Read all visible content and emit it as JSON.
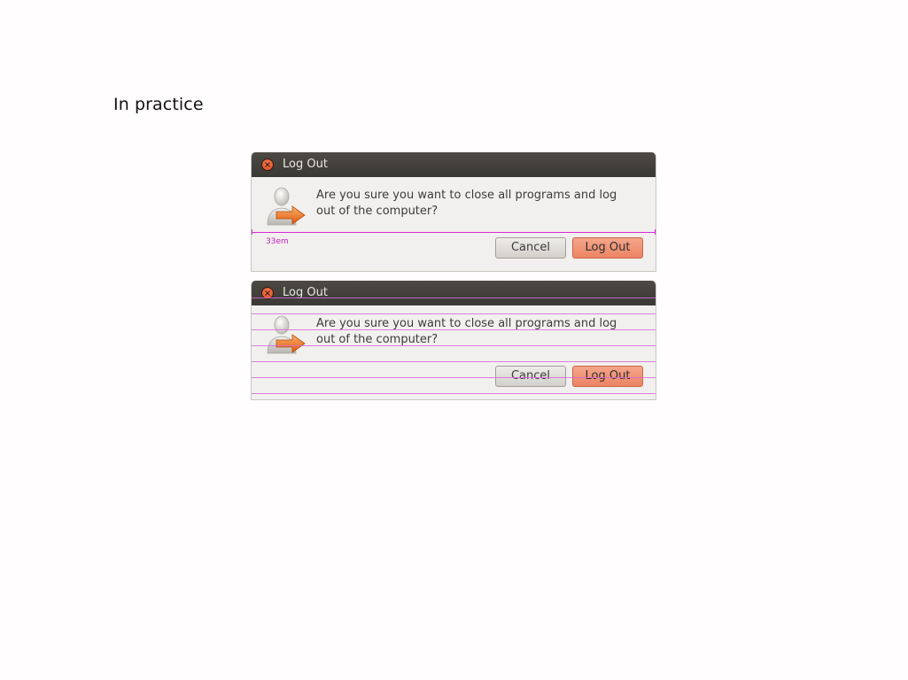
{
  "page": {
    "title": "In practice"
  },
  "dialogs": [
    {
      "window_title": "Log Out",
      "message": "Are you sure you want to close all programs and log out of the computer?",
      "buttons": {
        "cancel": "Cancel",
        "logout": "Log Out"
      },
      "overlay": {
        "type": "width-measure",
        "label": "33em"
      }
    },
    {
      "window_title": "Log Out",
      "message": "Are you sure you want to close all programs and log out of the computer?",
      "buttons": {
        "cancel": "Cancel",
        "logout": "Log Out"
      },
      "overlay": {
        "type": "baseline-grid"
      }
    }
  ],
  "icons": {
    "close": "close-icon",
    "logout": "user-logout-icon"
  },
  "colors": {
    "titlebar": "#3f3d39",
    "dialog_bg": "#f2f0ee",
    "accent_button": "#ef8e6e",
    "close_button": "#e25a31",
    "guide": "#d42bd4"
  }
}
